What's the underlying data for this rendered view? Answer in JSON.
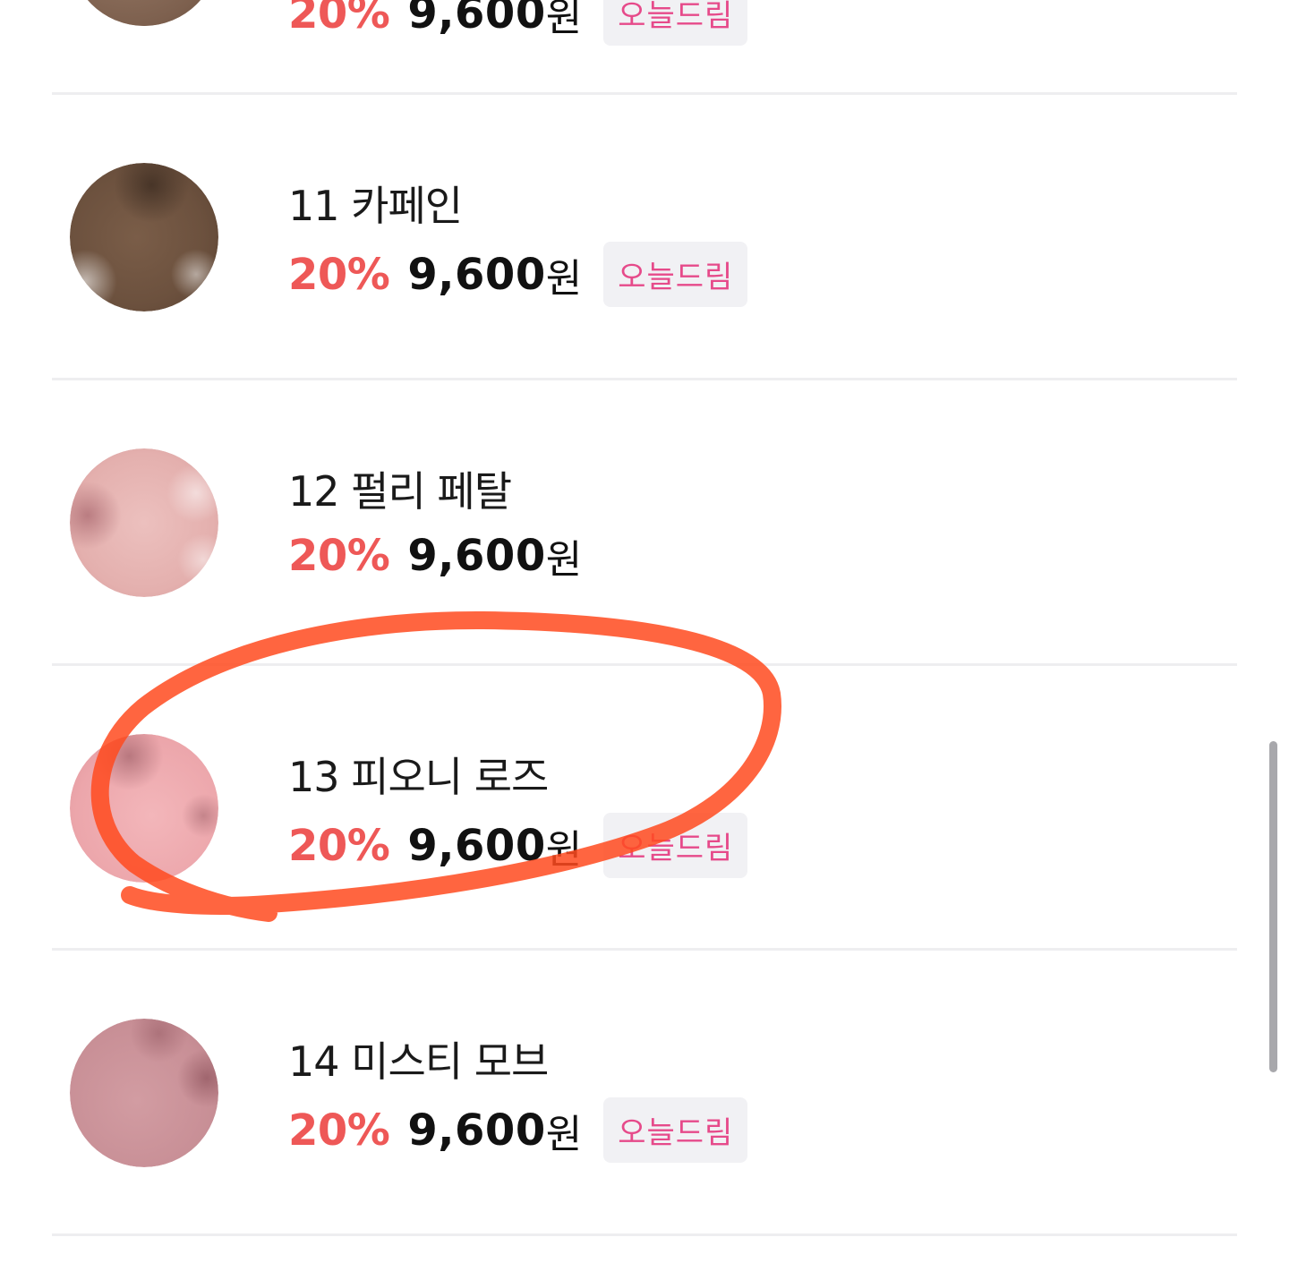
{
  "products": [
    {
      "name": "",
      "discount": "20%",
      "price": "9,600",
      "currency": "원",
      "badge": "",
      "swatch_color": "#8a6c5a"
    },
    {
      "name": "11 카페인",
      "discount": "20%",
      "price": "9,600",
      "currency": "원",
      "badge": "오늘드림",
      "swatch_color": "#6e5340"
    },
    {
      "name": "12 펄리 페탈",
      "discount": "20%",
      "price": "9,600",
      "currency": "원",
      "badge": "",
      "swatch_color": "#e8b8b6"
    },
    {
      "name": "13 피오니 로즈",
      "discount": "20%",
      "price": "9,600",
      "currency": "원",
      "badge": "오늘드림",
      "swatch_color": "#eda9ad"
    },
    {
      "name": "14 미스티 모브",
      "discount": "20%",
      "price": "9,600",
      "currency": "원",
      "badge": "오늘드림",
      "swatch_color": "#c99097"
    }
  ],
  "colors": {
    "discount": "#ee5857",
    "badge_text": "#e64a8a",
    "badge_bg": "#f1f1f4",
    "annotation": "#ff4a1f"
  }
}
